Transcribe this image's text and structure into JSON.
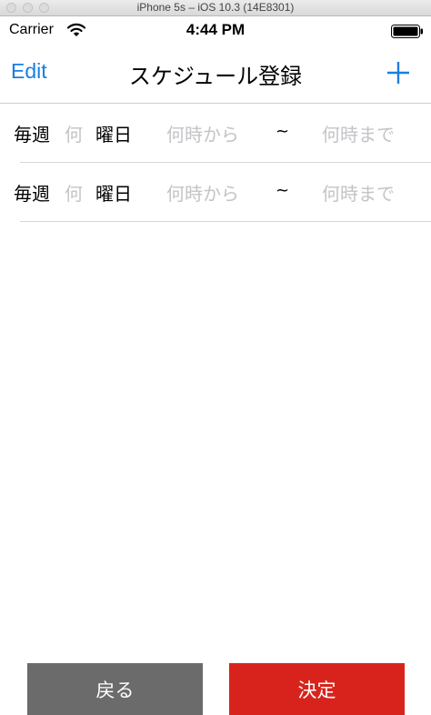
{
  "window": {
    "title": "iPhone 5s – iOS 10.3 (14E8301)"
  },
  "status_bar": {
    "carrier": "Carrier",
    "time": "4:44 PM",
    "wifi_icon": "wifi-icon",
    "battery_icon": "battery-icon"
  },
  "nav": {
    "edit_label": "Edit",
    "title": "スケジュール登録",
    "add_icon": "plus-icon",
    "accent_color": "#1a7fe0"
  },
  "rows": [
    {
      "weekly": "毎週",
      "day_placeholder": "何",
      "youbi": "曜日",
      "start_placeholder": "何時から",
      "separator": "~",
      "end_placeholder": "何時まで"
    },
    {
      "weekly": "毎週",
      "day_placeholder": "何",
      "youbi": "曜日",
      "start_placeholder": "何時から",
      "separator": "~",
      "end_placeholder": "何時まで"
    }
  ],
  "buttons": {
    "back_label": "戻る",
    "back_color": "#6b6b6b",
    "confirm_label": "決定",
    "confirm_color": "#d8231c"
  }
}
